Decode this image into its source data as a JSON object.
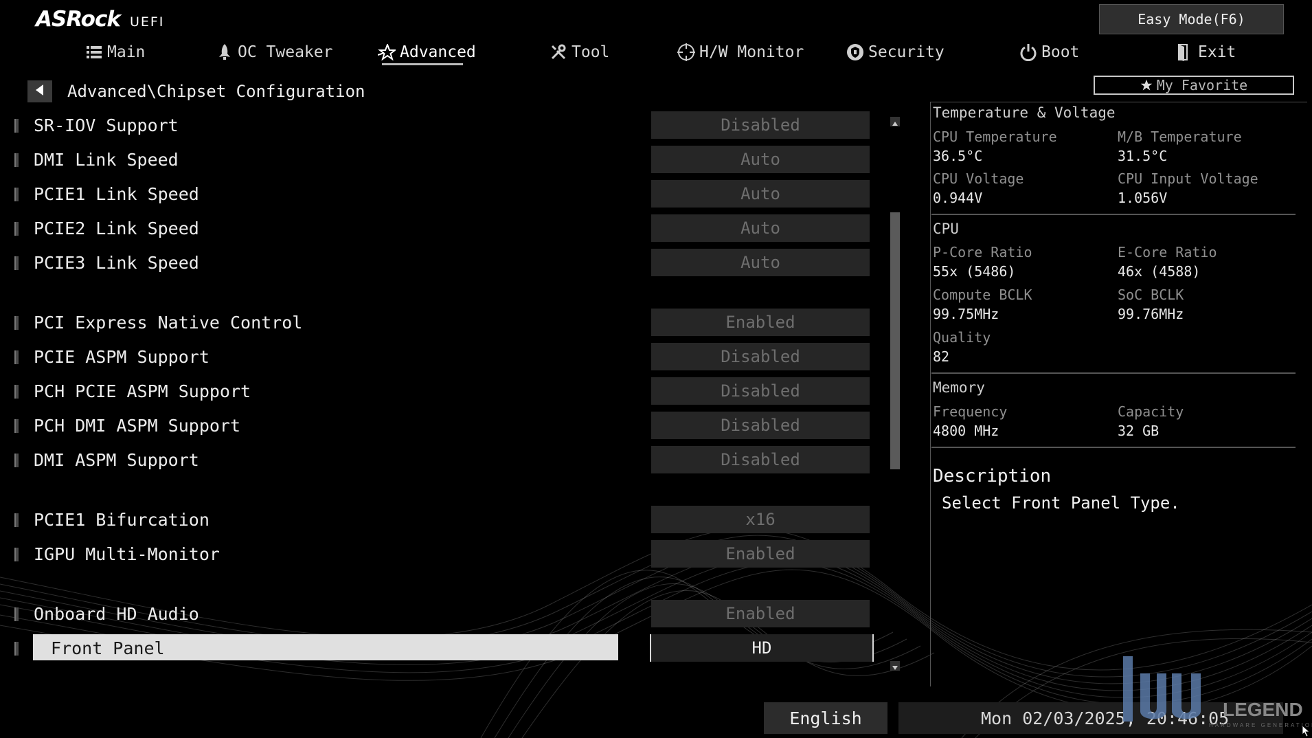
{
  "brand": {
    "name": "ASRock",
    "sub": "UEFI"
  },
  "top": {
    "easy_mode": "Easy Mode(F6)",
    "my_favorite": "My Favorite"
  },
  "tabs": [
    {
      "label": "Main",
      "icon": "list-icon"
    },
    {
      "label": "OC Tweaker",
      "icon": "rocket-icon"
    },
    {
      "label": "Advanced",
      "icon": "star-icon",
      "active": true
    },
    {
      "label": "Tool",
      "icon": "tools-icon"
    },
    {
      "label": "H/W Monitor",
      "icon": "crosshair-icon"
    },
    {
      "label": "Security",
      "icon": "shield-icon"
    },
    {
      "label": "Boot",
      "icon": "power-icon"
    },
    {
      "label": "Exit",
      "icon": "exit-icon"
    }
  ],
  "breadcrumb": "Advanced\\Chipset Configuration",
  "settings": [
    {
      "label": "SR-IOV Support",
      "value": "Disabled"
    },
    {
      "label": "DMI Link Speed",
      "value": "Auto"
    },
    {
      "label": "PCIE1 Link Speed",
      "value": "Auto"
    },
    {
      "label": "PCIE2 Link Speed",
      "value": "Auto"
    },
    {
      "label": "PCIE3 Link Speed",
      "value": "Auto"
    },
    {
      "label": "PCI Express Native Control",
      "value": "Enabled"
    },
    {
      "label": "PCIE ASPM Support",
      "value": "Disabled"
    },
    {
      "label": "PCH PCIE ASPM Support",
      "value": "Disabled"
    },
    {
      "label": "PCH DMI ASPM Support",
      "value": "Disabled"
    },
    {
      "label": "DMI ASPM Support",
      "value": "Disabled"
    },
    {
      "label": "PCIE1 Bifurcation",
      "value": "x16"
    },
    {
      "label": "IGPU Multi-Monitor",
      "value": "Enabled"
    },
    {
      "label": "Onboard HD Audio",
      "value": "Enabled"
    },
    {
      "label": "Front Panel",
      "value": "HD",
      "selected": true
    }
  ],
  "monitor": {
    "temp_voltage": {
      "title": "Temperature & Voltage",
      "cpu_temp_label": "CPU Temperature",
      "cpu_temp": "36.5°C",
      "mb_temp_label": "M/B Temperature",
      "mb_temp": "31.5°C",
      "cpu_volt_label": "CPU Voltage",
      "cpu_volt": "0.944V",
      "cpu_input_volt_label": "CPU Input Voltage",
      "cpu_input_volt": "1.056V"
    },
    "cpu": {
      "title": "CPU",
      "pcore_label": "P-Core Ratio",
      "pcore": "55x (5486)",
      "ecore_label": "E-Core Ratio",
      "ecore": "46x (4588)",
      "bclk_label": "Compute BCLK",
      "bclk": "99.75MHz",
      "soc_label": "SoC BCLK",
      "soc": "99.76MHz",
      "quality_label": "Quality",
      "quality": "82"
    },
    "memory": {
      "title": "Memory",
      "freq_label": "Frequency",
      "freq": "4800 MHz",
      "cap_label": "Capacity",
      "cap": "32 GB"
    }
  },
  "description": {
    "title": "Description",
    "text": "Select Front Panel Type."
  },
  "footer": {
    "language": "English",
    "datetime": "Mon 02/03/2025, 20:46:05"
  },
  "watermark": {
    "text": "LEGEND",
    "sub": "HARDWARE GENERATION"
  }
}
